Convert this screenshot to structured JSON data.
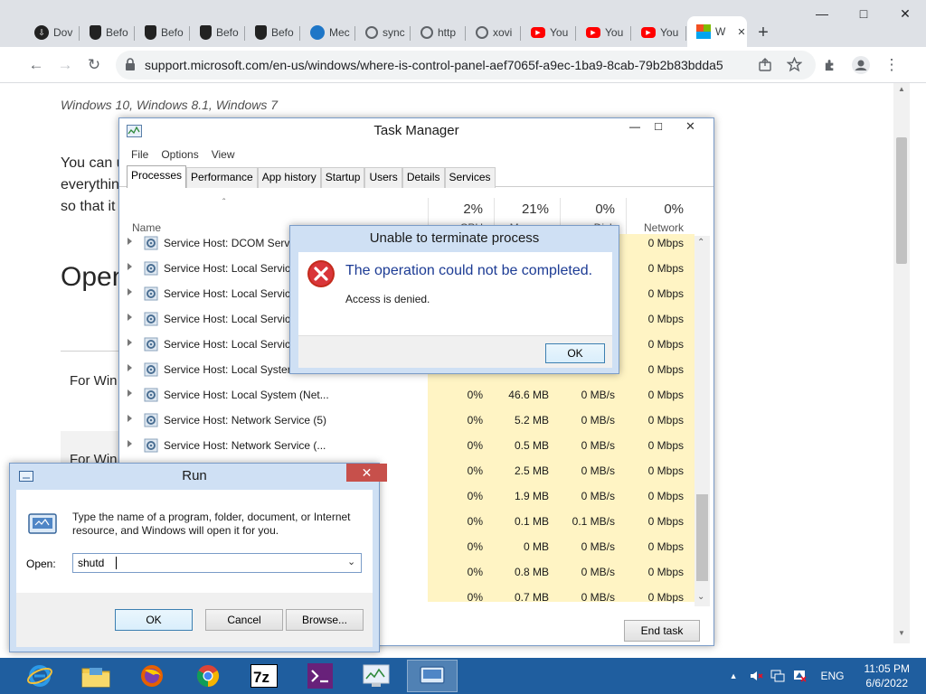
{
  "browser": {
    "tabs": [
      {
        "label": "Dov",
        "icon": "download-icon",
        "color": "#222222"
      },
      {
        "label": "Befo",
        "icon": "shield-icon",
        "color": "#222222"
      },
      {
        "label": "Befo",
        "icon": "shield-icon",
        "color": "#222222"
      },
      {
        "label": "Befo",
        "icon": "shield-icon",
        "color": "#222222"
      },
      {
        "label": "Befo",
        "icon": "shield-icon",
        "color": "#222222"
      },
      {
        "label": "Mec",
        "icon": "edge-icon",
        "color": "#1e76c7"
      },
      {
        "label": "sync",
        "icon": "globe-icon",
        "color": "#5f6368"
      },
      {
        "label": "http",
        "icon": "globe-icon",
        "color": "#5f6368"
      },
      {
        "label": "xovi",
        "icon": "globe-icon",
        "color": "#5f6368"
      },
      {
        "label": "You",
        "icon": "youtube-icon",
        "color": "#ff0000"
      },
      {
        "label": "You",
        "icon": "youtube-icon",
        "color": "#ff0000"
      },
      {
        "label": "You",
        "icon": "youtube-icon",
        "color": "#ff0000"
      },
      {
        "label": "W",
        "icon": "microsoft-icon",
        "color": "#f25022"
      }
    ],
    "new_tab": "+",
    "url": "support.microsoft.com/en-us/windows/where-is-control-panel-aef7065f-a9ec-1ba9-8cab-79b2b83bdda5"
  },
  "page": {
    "versions": "Windows 10, Windows 8.1, Windows 7",
    "para1": "You can u",
    "para2": "everythin",
    "para3": "so that it",
    "heading": "Open",
    "for1": "For Win",
    "for2": "For Win"
  },
  "task_manager": {
    "title": "Task Manager",
    "menu": [
      "File",
      "Options",
      "View"
    ],
    "tabs": [
      "Processes",
      "Performance",
      "App history",
      "Startup",
      "Users",
      "Details",
      "Services"
    ],
    "name_header": "Name",
    "cols": [
      {
        "pct": "2%",
        "label": "CPU"
      },
      {
        "pct": "21%",
        "label": "Memory"
      },
      {
        "pct": "0%",
        "label": "Disk"
      },
      {
        "pct": "0%",
        "label": "Network"
      }
    ],
    "rows": [
      {
        "name": "Service Host: DCOM Serv",
        "cpu": "",
        "mem": "",
        "disk": "",
        "net": "0 Mbps"
      },
      {
        "name": "Service Host: Local Servic",
        "cpu": "",
        "mem": "",
        "disk": "",
        "net": "0 Mbps"
      },
      {
        "name": "Service Host: Local Servic",
        "cpu": "",
        "mem": "",
        "disk": "",
        "net": "0 Mbps"
      },
      {
        "name": "Service Host: Local Servic",
        "cpu": "",
        "mem": "",
        "disk": "",
        "net": "0 Mbps"
      },
      {
        "name": "Service Host: Local Servic",
        "cpu": "",
        "mem": "",
        "disk": "",
        "net": "0 Mbps"
      },
      {
        "name": "Service Host: Local Syster",
        "cpu": "",
        "mem": "",
        "disk": "",
        "net": "0 Mbps"
      },
      {
        "name": "Service Host: Local System (Net...",
        "cpu": "0%",
        "mem": "46.6 MB",
        "disk": "0 MB/s",
        "net": "0 Mbps"
      },
      {
        "name": "Service Host: Network Service (5)",
        "cpu": "0%",
        "mem": "5.2 MB",
        "disk": "0 MB/s",
        "net": "0 Mbps"
      },
      {
        "name": "Service Host: Network Service (...",
        "cpu": "0%",
        "mem": "0.5 MB",
        "disk": "0 MB/s",
        "net": "0 Mbps"
      },
      {
        "name": "",
        "cpu": "0%",
        "mem": "2.5 MB",
        "disk": "0 MB/s",
        "net": "0 Mbps"
      },
      {
        "name": "",
        "cpu": "0%",
        "mem": "1.9 MB",
        "disk": "0 MB/s",
        "net": "0 Mbps"
      },
      {
        "name": "",
        "cpu": "0%",
        "mem": "0.1 MB",
        "disk": "0.1 MB/s",
        "net": "0 Mbps"
      },
      {
        "name": "",
        "cpu": "0%",
        "mem": "0 MB",
        "disk": "0 MB/s",
        "net": "0 Mbps"
      },
      {
        "name": "",
        "cpu": "0%",
        "mem": "0.8 MB",
        "disk": "0 MB/s",
        "net": "0 Mbps"
      },
      {
        "name": "",
        "cpu": "0%",
        "mem": "0.7 MB",
        "disk": "0 MB/s",
        "net": "0 Mbps"
      }
    ],
    "end_task": "End task"
  },
  "error_dialog": {
    "title": "Unable to terminate process",
    "heading": "The operation could not be completed.",
    "message": "Access is denied.",
    "ok": "OK"
  },
  "run_dialog": {
    "title": "Run",
    "description": "Type the name of a program, folder, document, or Internet resource, and Windows will open it for you.",
    "open_label": "Open:",
    "input_value": "shutd",
    "ok": "OK",
    "cancel": "Cancel",
    "browse": "Browse..."
  },
  "taskbar": {
    "language": "ENG",
    "time": "11:05 PM",
    "date": "6/6/2022"
  }
}
